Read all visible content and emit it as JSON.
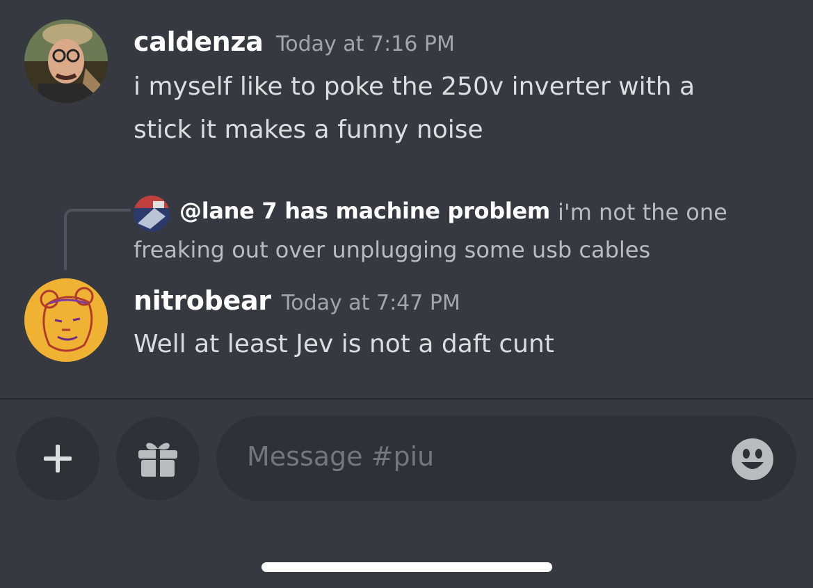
{
  "messages": [
    {
      "author": "caldenza",
      "timestamp": "Today at 7:16 PM",
      "lines": [
        "i myself like to poke the 250v inverter with a",
        "stick it makes a funny noise"
      ]
    },
    {
      "reply": {
        "author": "@lane 7 has machine problem",
        "text_line1": "i'm not the one",
        "text_line2": "freaking out over unplugging some usb cables"
      },
      "author": "nitrobear",
      "timestamp": "Today at 7:47 PM",
      "lines": [
        "Well at least Jev is not a daft cunt"
      ]
    }
  ],
  "composer": {
    "placeholder": "Message #piu",
    "add_icon": "plus-icon",
    "gift_icon": "gift-icon",
    "emoji_icon": "emoji-smile-icon"
  },
  "colors": {
    "background": "#36393f",
    "input_background": "#2f3136",
    "nitrobear_avatar": "#f0b232"
  }
}
